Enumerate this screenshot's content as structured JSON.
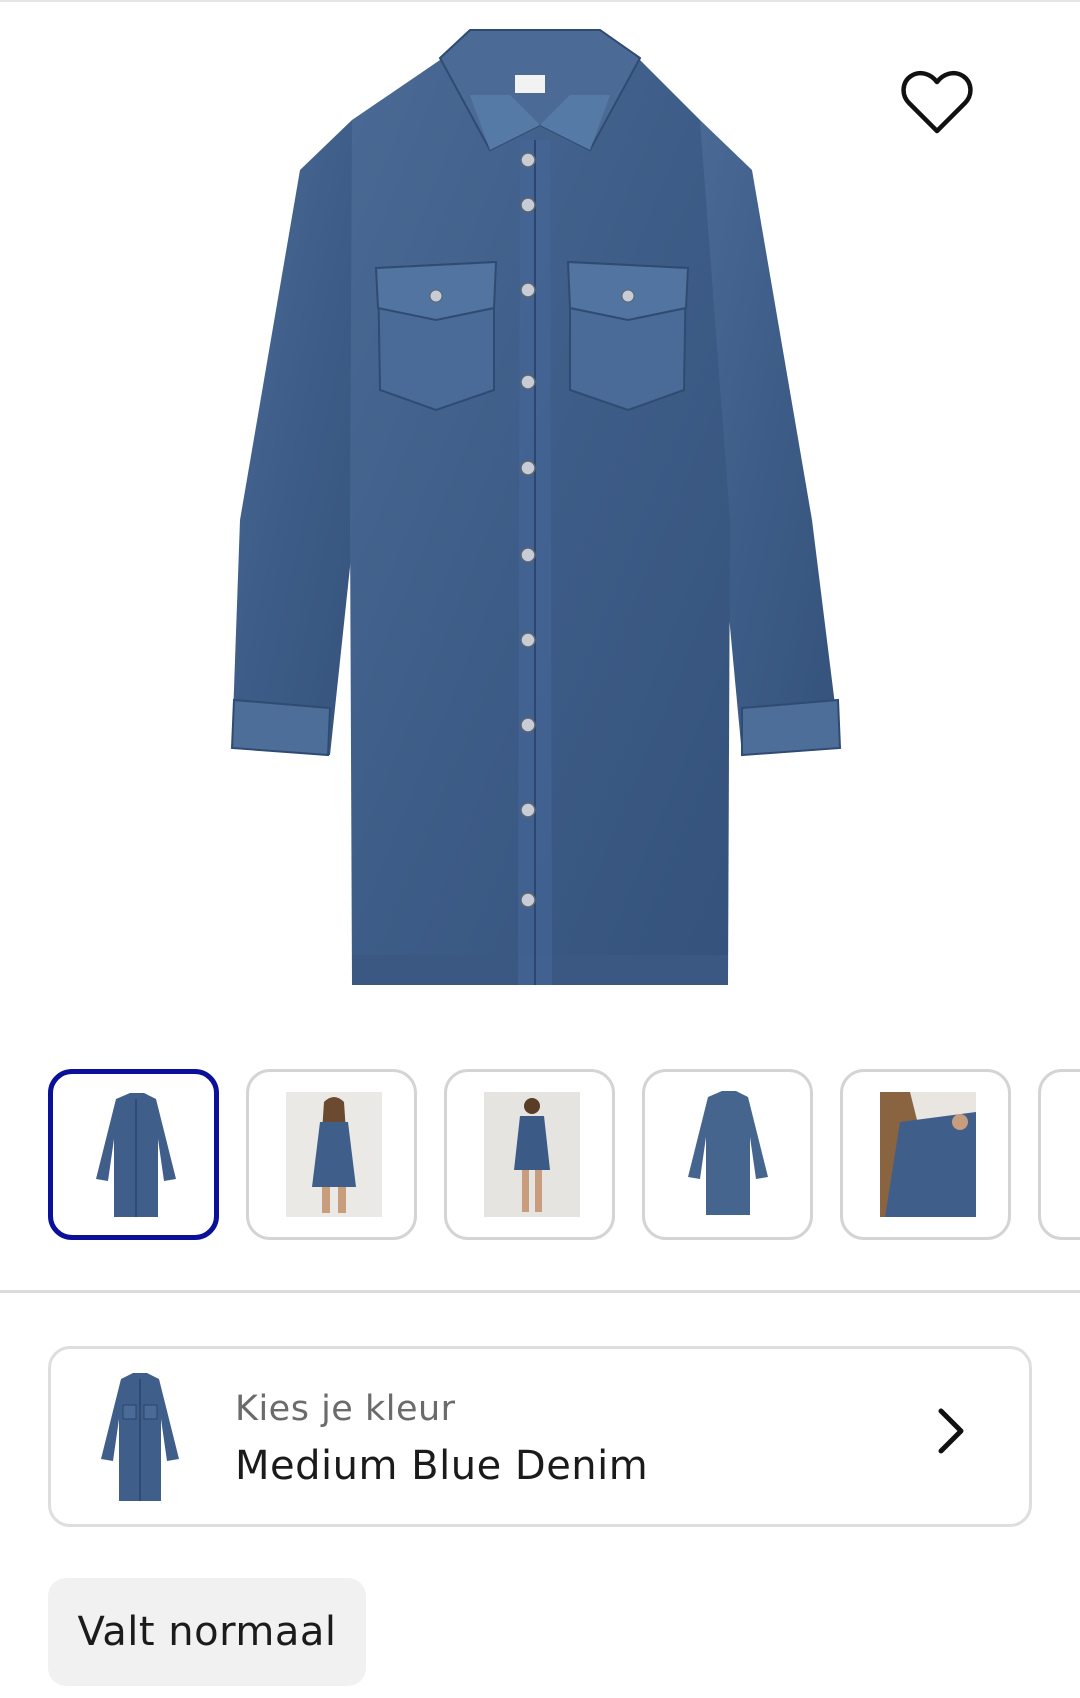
{
  "product": {
    "image_icon": "denim-shirt-dress-image",
    "favorite_icon": "heart-outline-icon"
  },
  "thumbnails": [
    {
      "name": "thumbnail-1",
      "depicts": "dress-front-flat",
      "active": true
    },
    {
      "name": "thumbnail-2",
      "depicts": "model-front",
      "active": false
    },
    {
      "name": "thumbnail-3",
      "depicts": "model-back",
      "active": false
    },
    {
      "name": "thumbnail-4",
      "depicts": "dress-back-flat",
      "active": false
    },
    {
      "name": "thumbnail-5",
      "depicts": "model-detail",
      "active": false
    },
    {
      "name": "thumbnail-6",
      "depicts": "more",
      "active": false
    }
  ],
  "color_selector": {
    "label": "Kies je kleur",
    "value": "Medium Blue Denim",
    "chevron_icon": "chevron-right-icon"
  },
  "fit_badge": {
    "label": "Valt normaal"
  },
  "colors": {
    "denim": "#3f5f8a",
    "denim_dark": "#2f4b72",
    "active_border": "#0b109a",
    "border": "#d4d4d4"
  }
}
